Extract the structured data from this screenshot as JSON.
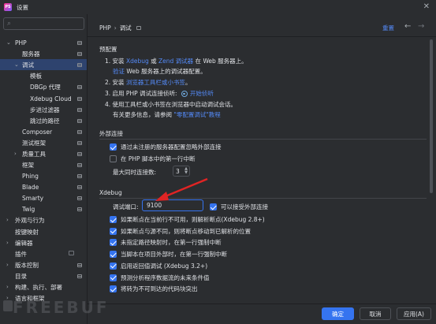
{
  "window": {
    "title": "设置",
    "logo_text": "PS"
  },
  "search": {
    "placeholder": ""
  },
  "tree": [
    {
      "label": "PHP",
      "arrow": "⌄",
      "proj": true,
      "selected": false
    },
    {
      "label": "服务器",
      "arrow": "",
      "proj": true,
      "selected": false
    },
    {
      "label": "调试",
      "arrow": "⌄",
      "proj": true,
      "selected": true
    },
    {
      "label": "模板",
      "arrow": "",
      "proj": false,
      "selected": false
    },
    {
      "label": "DBGp 代理",
      "arrow": "",
      "proj": true,
      "selected": false
    },
    {
      "label": "Xdebug Cloud",
      "arrow": "",
      "proj": true,
      "selected": false
    },
    {
      "label": "步进过滤器",
      "arrow": "",
      "proj": true,
      "selected": false
    },
    {
      "label": "跳过的路径",
      "arrow": "",
      "proj": true,
      "selected": false
    },
    {
      "label": "Composer",
      "arrow": "",
      "proj": true,
      "selected": false
    },
    {
      "label": "测试框架",
      "arrow": "",
      "proj": true,
      "selected": false
    },
    {
      "label": "质量工具",
      "arrow": "›",
      "proj": true,
      "selected": false
    },
    {
      "label": "框架",
      "arrow": "",
      "proj": true,
      "selected": false
    },
    {
      "label": "Phing",
      "arrow": "",
      "proj": true,
      "selected": false
    },
    {
      "label": "Blade",
      "arrow": "",
      "proj": true,
      "selected": false
    },
    {
      "label": "Smarty",
      "arrow": "",
      "proj": true,
      "selected": false
    },
    {
      "label": "Twig",
      "arrow": "",
      "proj": true,
      "selected": false
    },
    {
      "label": "外观与行为",
      "arrow": "›",
      "proj": false,
      "selected": false
    },
    {
      "label": "按键映射",
      "arrow": "",
      "proj": false,
      "selected": false
    },
    {
      "label": "编辑器",
      "arrow": "›",
      "proj": false,
      "selected": false
    },
    {
      "label": "插件",
      "arrow": "",
      "proj": false,
      "selected": false
    },
    {
      "label": "版本控制",
      "arrow": "›",
      "proj": true,
      "selected": false
    },
    {
      "label": "目录",
      "arrow": "",
      "proj": true,
      "selected": false
    },
    {
      "label": "构建、执行、部署",
      "arrow": "›",
      "proj": false,
      "selected": false
    },
    {
      "label": "语言和框架",
      "arrow": "›",
      "proj": false,
      "selected": false
    }
  ],
  "breadcrumb": {
    "parent": "PHP",
    "sep": "›",
    "current": "调试"
  },
  "header": {
    "reset": "重置",
    "back": "←",
    "forward": "→"
  },
  "pre_config": {
    "title": "预配置",
    "step1_prefix": "1. 安装 ",
    "step1_link1": "Xdebug",
    "step1_or": " 或 ",
    "step1_link2": "Zend 调试器",
    "step1_suffix": " 在 Web 服务器上。",
    "step1b_link": "验证",
    "step1b_suffix": " Web 服务器上的调试器配置。",
    "step2_prefix": "2. 安装 ",
    "step2_link": "浏览器工具栏或小书签",
    "step2_suffix": "。",
    "step3_prefix": "3. 启用 PHP 调试连接侦听: ",
    "step3_link": "开始侦听",
    "step4": "4. 使用工具栏或小书签在浏览器中启动调试会话。",
    "more_prefix": "有关更多信息，请参阅 ",
    "more_link": "\"零配置调试\"教程"
  },
  "external": {
    "title": "外部连接",
    "ignore_label": "通过未注册的服务器配置忽略外部连接",
    "break_first_label": "在 PHP 脚本中的第一行中断",
    "max_conn_label": "最大同时连接数:",
    "max_conn_value": "3"
  },
  "xdebug": {
    "title": "Xdebug",
    "port_label": "调试端口:",
    "port_value": "9100",
    "accept_external_label": "可以接受外部连接",
    "options": [
      {
        "label": "如果断点在当前行不可用，则解析断点(Xdebug 2.8+)",
        "checked": true
      },
      {
        "label": "如果断点与源不同，则将断点移动到已解析的位置",
        "checked": true
      },
      {
        "label": "未指定路径映射时，在第一行强制中断",
        "checked": true
      },
      {
        "label": "当脚本在项目外部时，在第一行强制中断",
        "checked": true
      },
      {
        "label": "启用返回值调试 (Xdebug 3.2+)",
        "checked": true
      },
      {
        "label": "预测分析程序数据流的未来条件值",
        "checked": true
      },
      {
        "label": "将转为不可到达的代码块突出",
        "checked": true
      }
    ]
  },
  "buttons": {
    "ok": "确定",
    "cancel": "取消",
    "apply": "应用(A)"
  },
  "watermark": "FREEBUF",
  "colors": {
    "accent": "#3574f0",
    "link": "#548af7",
    "background": "#2b2d30",
    "selection": "#2e436e"
  }
}
